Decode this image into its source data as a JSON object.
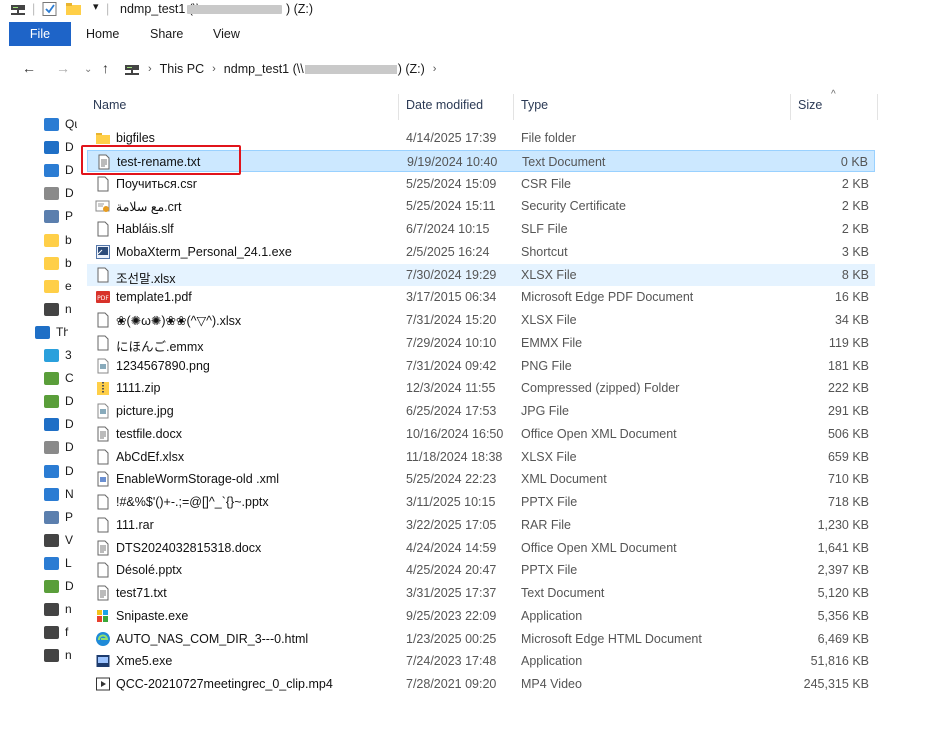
{
  "window": {
    "title": "ndmp_test1 (\\\\",
    "title_suffix": ") (Z:)"
  },
  "ribbon": {
    "file": "File",
    "tabs": [
      "Home",
      "Share",
      "View"
    ]
  },
  "address": {
    "this_pc": "This PC",
    "share_prefix": "ndmp_test1 (\\\\",
    "share_suffix": ") (Z:)"
  },
  "nav_pane": [
    {
      "icon": "star-icon",
      "text": "Qu",
      "color": "#2b7cd3"
    },
    {
      "icon": "desktop-icon",
      "text": "D",
      "color": "#1f6fc6"
    },
    {
      "icon": "download-icon",
      "text": "D",
      "color": "#2b7cd3"
    },
    {
      "icon": "documents-icon",
      "text": "D",
      "color": "#8a8a8a"
    },
    {
      "icon": "pictures-icon",
      "text": "P",
      "color": "#5b7fae"
    },
    {
      "icon": "folder-icon",
      "text": "b",
      "color": "#ffcf48"
    },
    {
      "icon": "folder-icon",
      "text": "b",
      "color": "#ffcf48"
    },
    {
      "icon": "folder-icon",
      "text": "e",
      "color": "#ffcf48"
    },
    {
      "icon": "network-drive-icon",
      "text": "n",
      "color": "#444"
    },
    {
      "icon": "this-pc-icon",
      "text": "Th",
      "color": "#1f6fc6"
    },
    {
      "icon": "3d-objects-icon",
      "text": "3",
      "color": "#2aa0dc"
    },
    {
      "icon": "network-drive-icon",
      "text": "C",
      "color": "#5a9e3a"
    },
    {
      "icon": "network-drive-icon",
      "text": "D",
      "color": "#5a9e3a"
    },
    {
      "icon": "desktop-icon",
      "text": "D",
      "color": "#1f6fc6"
    },
    {
      "icon": "documents-icon",
      "text": "D",
      "color": "#8a8a8a"
    },
    {
      "icon": "download-icon",
      "text": "D",
      "color": "#2b7cd3"
    },
    {
      "icon": "music-icon",
      "text": "N",
      "color": "#2b7cd3"
    },
    {
      "icon": "pictures-icon",
      "text": "P",
      "color": "#5b7fae"
    },
    {
      "icon": "videos-icon",
      "text": "V",
      "color": "#444"
    },
    {
      "icon": "drive-icon",
      "text": "L",
      "color": "#2b7cd3"
    },
    {
      "icon": "drive-icon",
      "text": "D",
      "color": "#5a9e3a"
    },
    {
      "icon": "network-drive-icon",
      "text": "n",
      "color": "#444"
    },
    {
      "icon": "network-drive-icon",
      "text": "f",
      "color": "#444"
    },
    {
      "icon": "network-drive-icon",
      "text": "n",
      "color": "#444"
    }
  ],
  "columns": {
    "name": "Name",
    "date": "Date modified",
    "type": "Type",
    "size": "Size"
  },
  "files": [
    {
      "name": "bigfiles",
      "date": "4/14/2025 17:39",
      "type": "File folder",
      "size": "",
      "icon": "folder-icon"
    },
    {
      "name": "test-rename.txt",
      "date": "9/19/2024 10:40",
      "type": "Text Document",
      "size": "0 KB",
      "icon": "text-file-icon",
      "state": "selected"
    },
    {
      "name": "Поучиться.csr",
      "date": "5/25/2024 15:09",
      "type": "CSR File",
      "size": "2 KB",
      "icon": "file-icon"
    },
    {
      "name": "مع سلامة.crt",
      "date": "5/25/2024 15:11",
      "type": "Security Certificate",
      "size": "2 KB",
      "icon": "certificate-icon"
    },
    {
      "name": "Habláis.slf",
      "date": "6/7/2024 10:15",
      "type": "SLF File",
      "size": "2 KB",
      "icon": "file-icon"
    },
    {
      "name": "MobaXterm_Personal_24.1.exe",
      "date": "2/5/2025 16:24",
      "type": "Shortcut",
      "size": "3 KB",
      "icon": "shortcut-icon"
    },
    {
      "name": "조선말.xlsx",
      "date": "7/30/2024 19:29",
      "type": "XLSX File",
      "size": "8 KB",
      "icon": "file-icon",
      "state": "hover"
    },
    {
      "name": "template1.pdf",
      "date": "3/17/2015 06:34",
      "type": "Microsoft Edge PDF Document",
      "size": "16 KB",
      "icon": "pdf-icon"
    },
    {
      "name": "❀(✺ω✺)❀❀(^▽^).xlsx",
      "date": "7/31/2024 15:20",
      "type": "XLSX File",
      "size": "34 KB",
      "icon": "file-icon"
    },
    {
      "name": "にほんご.emmx",
      "date": "7/29/2024 10:10",
      "type": "EMMX File",
      "size": "119 KB",
      "icon": "file-icon"
    },
    {
      "name": "1234567890.png",
      "date": "7/31/2024 09:42",
      "type": "PNG File",
      "size": "181 KB",
      "icon": "image-icon"
    },
    {
      "name": "1111.zip",
      "date": "12/3/2024 11:55",
      "type": "Compressed (zipped) Folder",
      "size": "222 KB",
      "icon": "zip-icon"
    },
    {
      "name": "picture.jpg",
      "date": "6/25/2024 17:53",
      "type": "JPG File",
      "size": "291 KB",
      "icon": "image-icon"
    },
    {
      "name": "testfile.docx",
      "date": "10/16/2024 16:50",
      "type": "Office Open XML Document",
      "size": "506 KB",
      "icon": "text-file-icon"
    },
    {
      "name": "AbCdEf.xlsx",
      "date": "11/18/2024 18:38",
      "type": "XLSX File",
      "size": "659 KB",
      "icon": "file-icon"
    },
    {
      "name": "EnableWormStorage-old .xml",
      "date": "5/25/2024 22:23",
      "type": "XML Document",
      "size": "710 KB",
      "icon": "xml-icon"
    },
    {
      "name": "!#&%$'()+-.;=@[]^_`{}~.pptx",
      "date": "3/11/2025 10:15",
      "type": "PPTX File",
      "size": "718 KB",
      "icon": "file-icon"
    },
    {
      "name": "111.rar",
      "date": "3/22/2025 17:05",
      "type": "RAR File",
      "size": "1,230 KB",
      "icon": "file-icon"
    },
    {
      "name": "DTS2024032815318.docx",
      "date": "4/24/2024 14:59",
      "type": "Office Open XML Document",
      "size": "1,641 KB",
      "icon": "text-file-icon"
    },
    {
      "name": "Désolé.pptx",
      "date": "4/25/2024 20:47",
      "type": "PPTX File",
      "size": "2,397 KB",
      "icon": "file-icon"
    },
    {
      "name": "test71.txt",
      "date": "3/31/2025 17:37",
      "type": "Text Document",
      "size": "5,120 KB",
      "icon": "text-file-icon"
    },
    {
      "name": "Snipaste.exe",
      "date": "9/25/2023 22:09",
      "type": "Application",
      "size": "5,356 KB",
      "icon": "snipaste-icon"
    },
    {
      "name": "AUTO_NAS_COM_DIR_3---0.html",
      "date": "1/23/2025 00:25",
      "type": "Microsoft Edge HTML Document",
      "size": "6,469 KB",
      "icon": "edge-icon"
    },
    {
      "name": "Xme5.exe",
      "date": "7/24/2023 17:48",
      "type": "Application",
      "size": "51,816 KB",
      "icon": "app-icon"
    },
    {
      "name": "QCC-20210727meetingrec_0_clip.mp4",
      "date": "7/28/2021 09:20",
      "type": "MP4 Video",
      "size": "245,315 KB",
      "icon": "video-file-icon"
    }
  ]
}
